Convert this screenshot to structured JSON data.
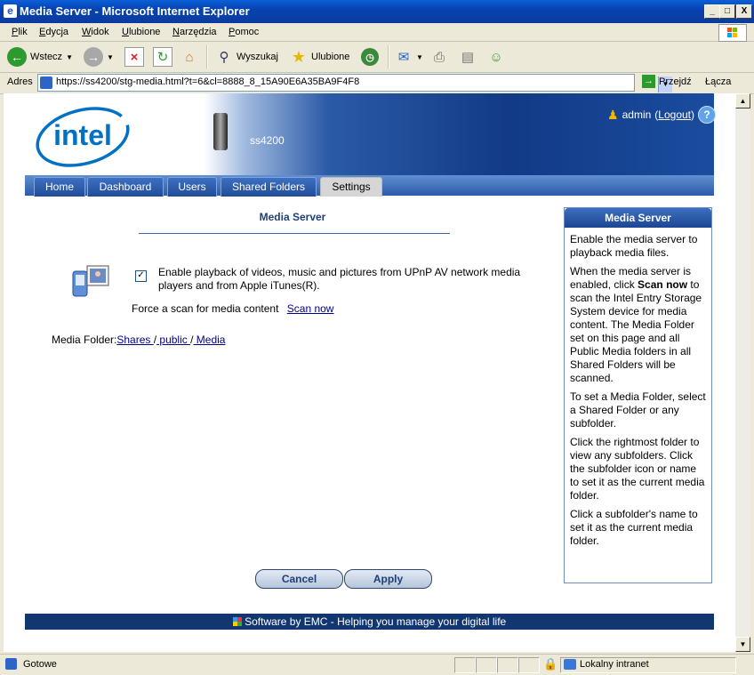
{
  "window": {
    "title": "Media Server - Microsoft Internet Explorer",
    "controls": [
      "_",
      "□",
      "X"
    ]
  },
  "menu": [
    "Plik",
    "Edycja",
    "Widok",
    "Ulubione",
    "Narzędzia",
    "Pomoc"
  ],
  "toolbar": {
    "back": "Wstecz",
    "search": "Wyszukaj",
    "favorites": "Ulubione"
  },
  "address": {
    "label": "Adres",
    "url": "https://ss4200/stg-media.html?t=6&cl=8888_8_15A90E6A35BA9F4F8",
    "go": "Przejdź",
    "links": "Łącza"
  },
  "header": {
    "logo": "intel",
    "device": "ss4200",
    "user": "admin",
    "logout_open": "(",
    "logout": "Logout",
    "logout_close": ")",
    "help": "?"
  },
  "tabs": [
    "Home",
    "Dashboard",
    "Users",
    "Shared Folders",
    "Settings"
  ],
  "active_tab": "Settings",
  "main": {
    "title": "Media Server",
    "enable_text": "Enable playback of videos, music and pictures from UPnP AV network media players and from Apple iTunes(R).",
    "enable_checked": true,
    "check_mark": "✓",
    "scan_label": "Force a scan for media content",
    "scan_link": "Scan now",
    "folder_label": "Media Folder:",
    "folder_path": [
      "Shares ",
      " public ",
      " Media"
    ],
    "folder_sep": "/"
  },
  "sidebar": {
    "title": "Media Server",
    "p1": "Enable the media server to playback media files.",
    "p2a": "When the media server is enabled, click ",
    "p2b": "Scan now",
    "p2c": " to scan the Intel Entry Storage System device for media content. The Media Folder set on this page and all Public Media folders in all Shared Folders will be scanned.",
    "p3": "To set a Media Folder, select a Shared Folder or any subfolder.",
    "p4": "Click the rightmost folder to view any subfolders. Click the subfolder icon or name to set it as the current media folder.",
    "p5": "Click a subfolder's name to set it as the current media folder."
  },
  "buttons": {
    "cancel": "Cancel",
    "apply": "Apply"
  },
  "footer": "Software by EMC - Helping you manage your digital life",
  "status": {
    "text": "Gotowe",
    "zone": "Lokalny intranet"
  },
  "colors": {
    "ie_blue": "#0842b0",
    "intel_blue": "#0071c5",
    "banner_dark": "#123a86",
    "footer": "#12366f"
  }
}
